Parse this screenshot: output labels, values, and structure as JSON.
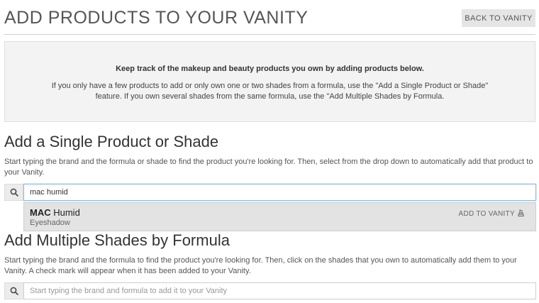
{
  "header": {
    "title": "ADD PRODUCTS TO YOUR VANITY",
    "back_label": "BACK TO VANITY"
  },
  "info": {
    "heading": "Keep track of the makeup and beauty products you own by adding products below.",
    "text": "If you only have a few products to add or only own one or two shades from a formula, use the \"Add a Single Product or Shade\" feature. If you own several shades from the same formula, use the \"Add Multiple Shades by Formula."
  },
  "single": {
    "title": "Add a Single Product or Shade",
    "description": "Start typing the brand and the formula or shade to find the product you're looking for. Then, select from the drop down to automatically add that product to your Vanity.",
    "search_value": "mac humid",
    "suggestion": {
      "brand": "MAC",
      "name": "Humid",
      "type": "Eyeshadow",
      "add_label": "ADD TO VANITY"
    }
  },
  "multiple": {
    "title": "Add Multiple Shades by Formula",
    "description": "Start typing the brand and the formula to find the product you're looking for. Then, click on the shades that you own to automatically add them to your Vanity. A check mark will appear when it has been added to your Vanity.",
    "search_placeholder": "Start typing the brand and formula to add it to your Vanity"
  },
  "icons": {
    "search": "search-icon",
    "add": "lipstick-icon"
  }
}
